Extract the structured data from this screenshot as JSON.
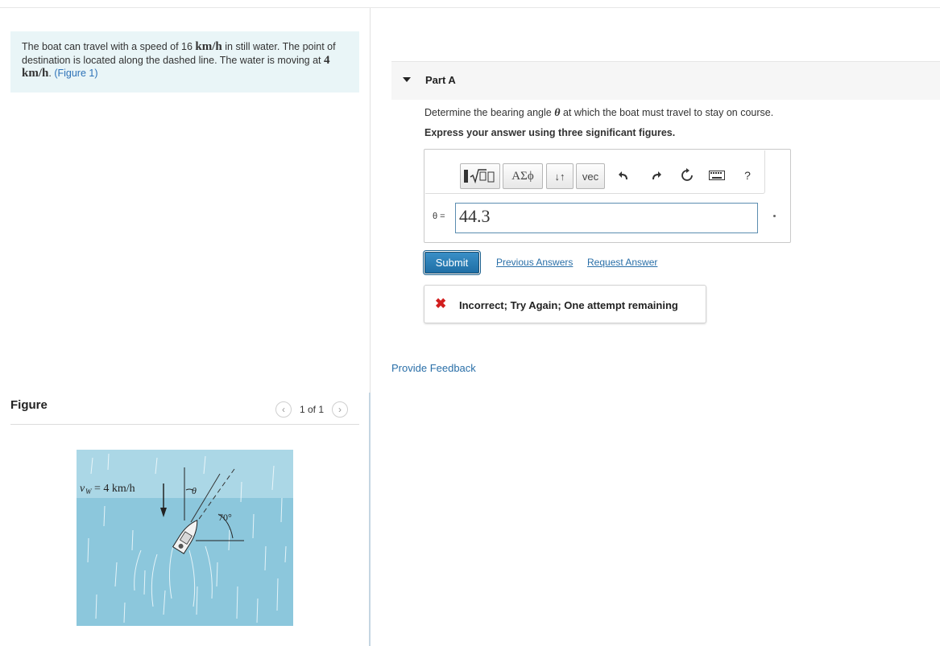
{
  "problem": {
    "text_1": "The boat can travel with a speed of 16 ",
    "speed_expr": "km/h",
    "text_2": " in still water. The point of destination is located along the dashed line. The water is moving at ",
    "water_expr": "4 km/h",
    "text_3": ". ",
    "figure_link": "(Figure 1)"
  },
  "figure_panel": {
    "title": "Figure",
    "page_indicator": "1 of 1",
    "prev_icon": "chevron-left-icon",
    "next_icon": "chevron-right-icon",
    "diagram": {
      "water_label": "vw = 4 km/h",
      "theta_label": "θ",
      "angle_label": "70°",
      "water_color": "#8cc7dc"
    }
  },
  "partA": {
    "title": "Part A",
    "question_pre": "Determine the bearing angle ",
    "question_symbol": "θ",
    "question_post": " at which the boat must travel to stay on course.",
    "instruction": "Express your answer using three significant figures.",
    "toolbar": {
      "templates": "template-sqrt-icon",
      "greek": "ΑΣϕ",
      "arrows": "↓↑",
      "vec": "vec",
      "undo_icon": "undo-icon",
      "redo_icon": "redo-icon",
      "reset_icon": "reset-icon",
      "keyboard_icon": "keyboard-icon",
      "help": "?"
    },
    "answer_label": "θ =",
    "answer_value": "44.3",
    "submit_label": "Submit",
    "previous_answers": "Previous Answers",
    "request_answer": "Request Answer",
    "feedback": "Incorrect; Try Again; One attempt remaining",
    "feedback_icon": "x-icon"
  },
  "provide_feedback": "Provide Feedback"
}
